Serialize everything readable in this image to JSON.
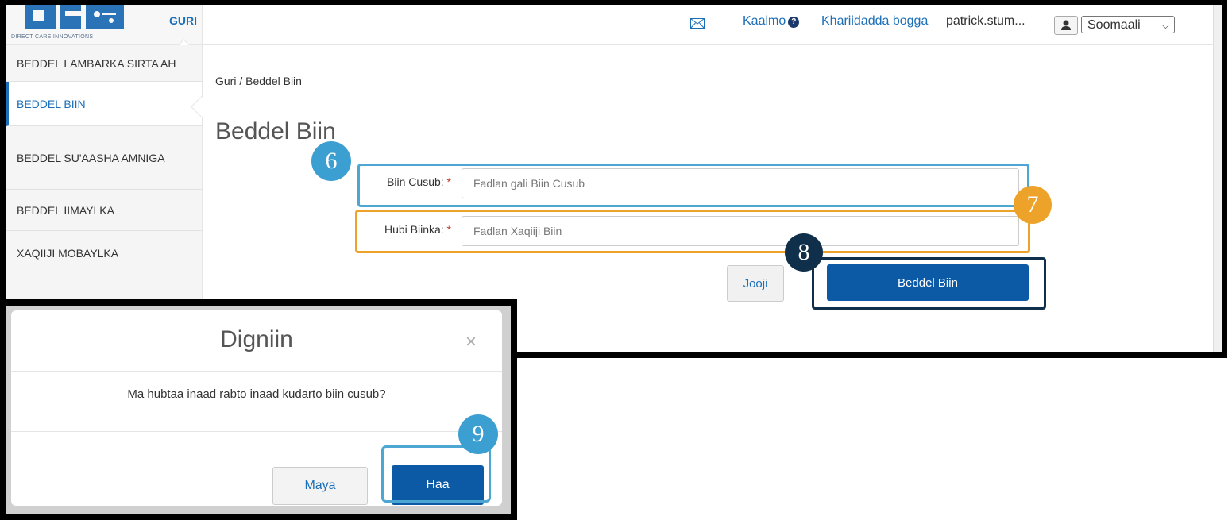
{
  "header": {
    "logo_text": "DIRECT CARE INNOVATIONS",
    "home_link": "GURI",
    "help_link": "Kaalmo",
    "sitemap_link": "Khariidadda bogga",
    "user_name": "patrick.stum...",
    "language": "Soomaali"
  },
  "sidebar": {
    "items": [
      {
        "label": "BEDDEL LAMBARKA SIRTA AH"
      },
      {
        "label": "BEDDEL BIIN"
      },
      {
        "label": "BEDDEL SU'AASHA AMNIGA"
      },
      {
        "label": "BEDDEL IIMAYLKA"
      },
      {
        "label": "XAQIIJI MOBAYLKA"
      }
    ]
  },
  "main": {
    "breadcrumb": "Guri / Beddel Biin",
    "title": "Beddel Biin",
    "fields": [
      {
        "label": "Biin Cusub:",
        "required": "*",
        "placeholder": "Fadlan gali Biin Cusub"
      },
      {
        "label": "Hubi Biinka:",
        "required": "*",
        "placeholder": "Fadlan Xaqiiji Biin"
      }
    ],
    "cancel_label": "Jooji",
    "submit_label": "Beddel Biin"
  },
  "dialog": {
    "title": "Digniin",
    "close_glyph": "×",
    "message": "Ma hubtaa inaad rabto inaad kudarto biin cusub?",
    "no_label": "Maya",
    "yes_label": "Haa"
  },
  "callouts": {
    "step6": "6",
    "step7": "7",
    "step8": "8",
    "step9": "9"
  },
  "colors": {
    "primary": "#0c5aa6",
    "link": "#1b6fb8",
    "callout_blue": "#3c9fd1",
    "callout_orange": "#eda32a",
    "callout_navy": "#0f2f4b"
  },
  "icons": [
    "mail-icon",
    "help-icon",
    "user-icon",
    "chevron-down-icon",
    "close-icon"
  ]
}
